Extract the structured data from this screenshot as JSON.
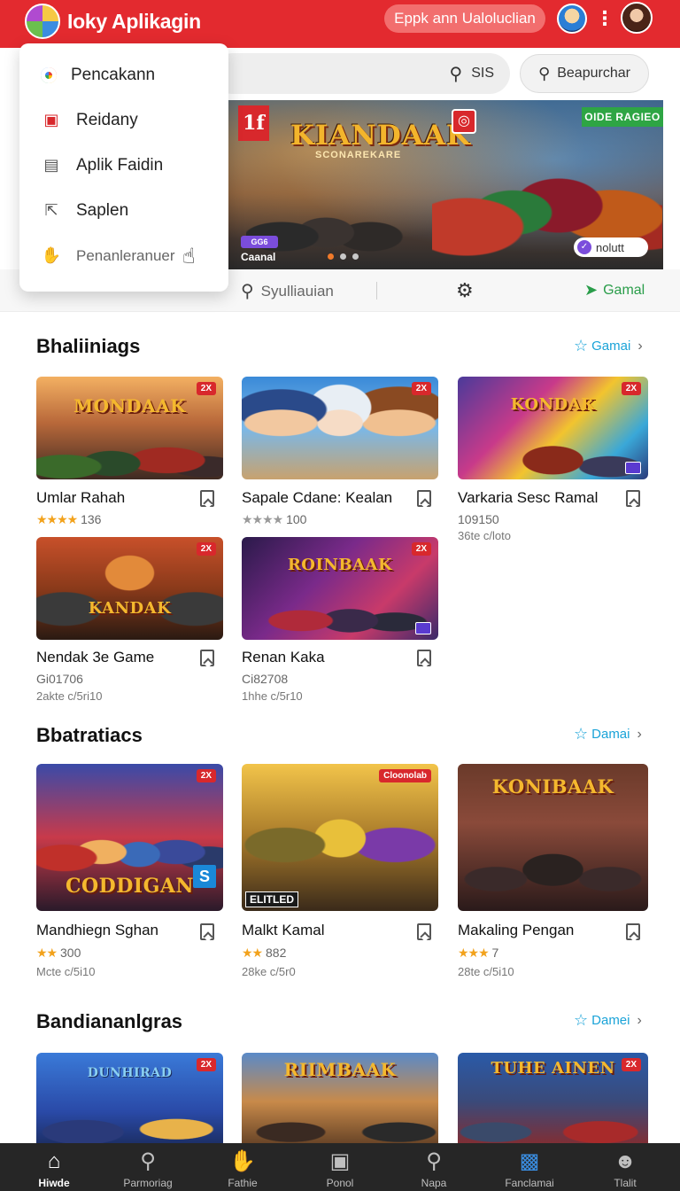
{
  "header": {
    "app_title": "Ioky Aplikagin",
    "pill_label": "Eppk ann Ualoluclian",
    "more_icon": "more-vert-icon"
  },
  "search": {
    "text": "SIS",
    "icon": "search-icon"
  },
  "explore_button": {
    "label": "Beapurchar",
    "icon": "search-icon"
  },
  "banner": {
    "badge": "1f",
    "title": "KIANDAAK",
    "subtitle": "SCONAREKARE",
    "ribbon": "OIDE RAGIEO",
    "chip": "GG6",
    "caption": "Caanal",
    "pill": "nolutt",
    "dots_total": 3,
    "dots_active": 0
  },
  "action_row": {
    "search_label": "Syulliauian",
    "gear_icon": "gear-icon",
    "game_label": "Gamal"
  },
  "menu": {
    "items": [
      {
        "label": "Pencakann",
        "icon": "google-icon"
      },
      {
        "label": "Reidany",
        "icon": "screen-icon"
      },
      {
        "label": "Aplik Faidin",
        "icon": "image-icon"
      },
      {
        "label": "Saplen",
        "icon": "share-icon"
      },
      {
        "label": "Penanleranuer",
        "icon": "thumbs-up-icon"
      }
    ]
  },
  "sections": [
    {
      "title": "Bhaliiniags",
      "link": "Gamai",
      "cards": [
        {
          "name": "Umlar Rahah",
          "stars": "★★★★",
          "meta": "136",
          "sub": "",
          "art": "MONDAAK",
          "tag": "2X"
        },
        {
          "name": "Sapale Cdane: Kealan",
          "stars": "★★★★",
          "meta": "100",
          "sub": "",
          "art": "",
          "tag": "2X"
        },
        {
          "name": "Varkaria Sesc Ramal",
          "stars": "",
          "meta": "109150",
          "sub": "36te c/loto",
          "art": "KONDAK",
          "tag": "2X"
        },
        {
          "name": "Nendak 3e Game",
          "stars": "",
          "meta": "Gi01706",
          "sub": "2akte c/5ri10",
          "art": "KANDAK",
          "tag": "2X"
        },
        {
          "name": "Renan Kaka",
          "stars": "",
          "meta": "Ci82708",
          "sub": "1hhe c/5r10",
          "art": "ROINBAAK",
          "tag": "2X"
        }
      ]
    },
    {
      "title": "Bbatratiacs",
      "link": "Damai",
      "cards": [
        {
          "name": "Mandhiegn Sghan",
          "stars": "★★",
          "meta": "300",
          "sub": "Mcte c/5i10",
          "art": "CODDIGAN",
          "tag": "2X"
        },
        {
          "name": "Malkt Kamal",
          "stars": "★★",
          "meta": "882",
          "sub": "28ke c/5r0",
          "art": "ELITLED",
          "tag": "Cloonolab"
        },
        {
          "name": "Makaling Pengan",
          "stars": "★★★",
          "meta": "7",
          "sub": "28te c/5i10",
          "art": "KONIBAAK",
          "tag": ""
        }
      ]
    },
    {
      "title": "Bandiananlgras",
      "link": "Damei",
      "cards": [
        {
          "name": "",
          "art": "DUNHIRAD",
          "tag": "2X"
        },
        {
          "name": "",
          "art": "RIIMBAAK",
          "tag": ""
        },
        {
          "name": "",
          "art": "TUHE AINEN",
          "tag": "2X"
        }
      ]
    }
  ],
  "bottom_nav": [
    {
      "label": "Hiwde",
      "icon": "home-icon",
      "active": true
    },
    {
      "label": "Parmoriag",
      "icon": "search-icon"
    },
    {
      "label": "Fathie",
      "icon": "hand-icon"
    },
    {
      "label": "Ponol",
      "icon": "box-icon"
    },
    {
      "label": "Napa",
      "icon": "search-icon"
    },
    {
      "label": "Fanclamai",
      "icon": "news-icon"
    },
    {
      "label": "Tlalit",
      "icon": "user-icon"
    }
  ],
  "colors": {
    "header_red": "#e32a2f",
    "link_blue": "#1aa3d8",
    "star_gold": "#f2a21c",
    "nav_dark": "#262626",
    "green_accent": "#2a9d4a"
  }
}
